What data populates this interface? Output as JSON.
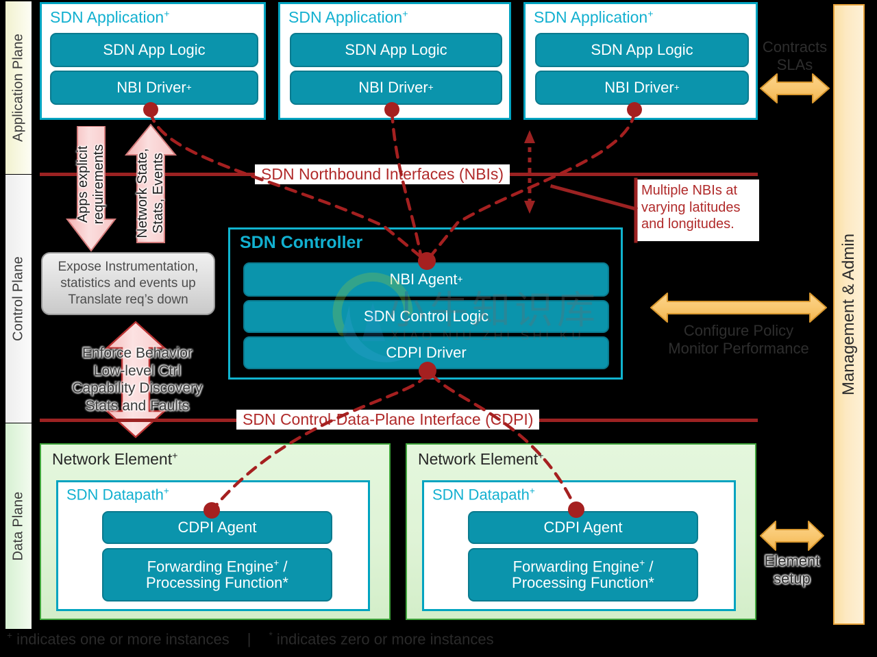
{
  "planes": [
    {
      "id": "application",
      "label": "Application Plane"
    },
    {
      "id": "control",
      "label": "Control Plane"
    },
    {
      "id": "data",
      "label": "Data Plane"
    }
  ],
  "applications": [
    {
      "title": "SDN Application",
      "sup": "+",
      "logic": "SDN App Logic",
      "driver": "NBI Driver",
      "driver_sup": "+"
    },
    {
      "title": "SDN Application",
      "sup": "+",
      "logic": "SDN App Logic",
      "driver": "NBI Driver",
      "driver_sup": "+"
    },
    {
      "title": "SDN Application",
      "sup": "+",
      "logic": "SDN App Logic",
      "driver": "NBI Driver",
      "driver_sup": "+"
    }
  ],
  "controller": {
    "title": "SDN Controller",
    "rows": [
      {
        "label": "NBI Agent",
        "sup": "+"
      },
      {
        "label": "SDN Control Logic",
        "sup": ""
      },
      {
        "label": "CDPI Driver",
        "sup": ""
      }
    ]
  },
  "network_elements": [
    {
      "title": "Network Element",
      "sup": "+",
      "datapath": "SDN Datapath",
      "datapath_sup": "+",
      "agent": "CDPI Agent",
      "engine_line1": "Forwarding Engine",
      "engine_sup": "+",
      "engine_slash": " /",
      "engine_line2": "Processing Function",
      "engine_line2_sup": "*"
    },
    {
      "title": "Network Element",
      "sup": "+",
      "datapath": "SDN Datapath",
      "datapath_sup": "+",
      "agent": "CDPI Agent",
      "engine_line1": "Forwarding Engine",
      "engine_sup": "+",
      "engine_slash": " /",
      "engine_line2": "Processing Function",
      "engine_line2_sup": "*"
    }
  ],
  "interfaces": {
    "nbi_label": "SDN Northbound Interfaces (NBIs)",
    "cdpi_label": "SDN Control-Data-Plane Interface (CDPI)"
  },
  "callout": {
    "nbi_note": "Multiple NBIs at varying latitudes and longitudes."
  },
  "arrows": {
    "apps_requirements": "Apps explicit requirements",
    "network_state": "Network State, Stats, Events",
    "expose_box": "Expose Instrumentation, statistics and events up Translate req’s down",
    "enforce": "Enforce Behavior Low-level Ctrl Capability Discovery Stats and Faults",
    "contracts_line1": "Contracts",
    "contracts_line2": "SLAs",
    "configure_line1": "Configure Policy",
    "configure_line2": "Monitor Performance",
    "element_line1": "Element",
    "element_line2": "setup"
  },
  "management": {
    "label": "Management & Admin"
  },
  "footer": {
    "plus_sup": "+",
    "plus_text": "indicates one or more instances",
    "separator": "|",
    "star_sup": "*",
    "star_text": "indicates zero or more instances"
  },
  "watermark": {
    "cn": "小牛知识库",
    "en": "XIAO NIU ZHI SHI KU"
  },
  "colors": {
    "teal": "#0b94ac",
    "teal_border": "#00a3c0",
    "interface_red": "#9c2222",
    "label_red": "#b02a2a",
    "dot_red": "#a52020",
    "pink_arrow": "#f6c4c4",
    "orange": "#f5c26b",
    "orange_border": "#e8a33a",
    "green_border": "#3fa53b",
    "background": "#000000"
  }
}
